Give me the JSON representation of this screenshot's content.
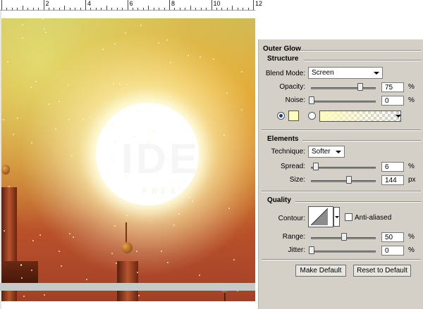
{
  "ruler": {
    "labels": [
      "2",
      "4",
      "6",
      "8",
      "10",
      "12"
    ]
  },
  "watermark": {
    "main": "IDE",
    "sub": "FREE"
  },
  "panel": {
    "title": "Outer Glow",
    "structure": {
      "heading": "Structure",
      "blend_mode_label": "Blend Mode:",
      "blend_mode_value": "Screen",
      "opacity_label": "Opacity:",
      "opacity_value": "75",
      "opacity_unit": "%",
      "opacity_level": 0.75,
      "noise_label": "Noise:",
      "noise_value": "0",
      "noise_unit": "%",
      "noise_level": 0.0,
      "glow_color": "#fffcbc"
    },
    "elements": {
      "heading": "Elements",
      "technique_label": "Technique:",
      "technique_value": "Softer",
      "spread_label": "Spread:",
      "spread_value": "6",
      "spread_unit": "%",
      "spread_level": 0.06,
      "size_label": "Size:",
      "size_value": "144",
      "size_unit": "px",
      "size_level": 0.58
    },
    "quality": {
      "heading": "Quality",
      "contour_label": "Contour:",
      "antialiased_label": "Anti-aliased",
      "antialiased_checked": false,
      "range_label": "Range:",
      "range_value": "50",
      "range_unit": "%",
      "range_level": 0.5,
      "jitter_label": "Jitter:",
      "jitter_value": "0",
      "jitter_unit": "%",
      "jitter_level": 0.0
    },
    "buttons": {
      "make_default": "Make Default",
      "reset_default": "Reset to Default"
    }
  }
}
